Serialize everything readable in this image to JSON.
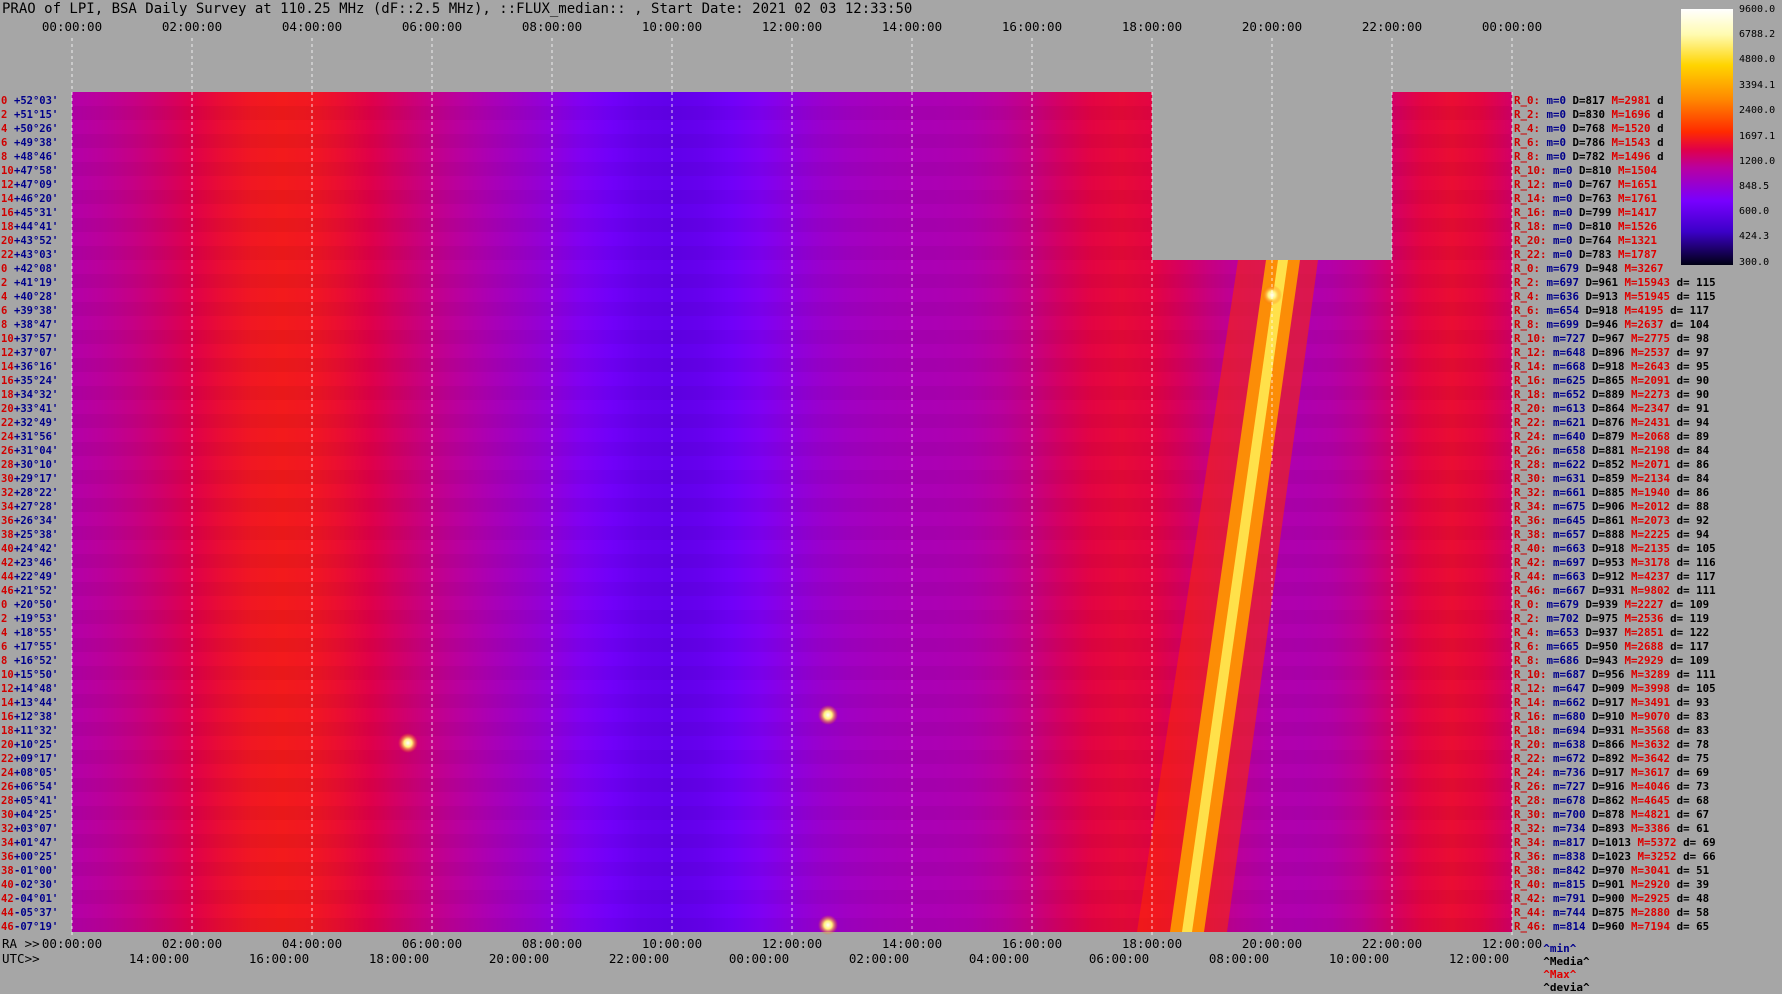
{
  "title": "PRAO of LPI, BSA Daily Survey at 110.25 MHz (dF::2.5 MHz), ::FLUX_median:: , Start Date: 2021 02 03 12:33:50",
  "top_utc_ticks": [
    "00:00:00",
    "02:00:00",
    "04:00:00",
    "06:00:00",
    "08:00:00",
    "10:00:00",
    "12:00:00",
    "14:00:00",
    "16:00:00",
    "18:00:00",
    "20:00:00",
    "22:00:00",
    "00:00:00"
  ],
  "bottom_ra_prefix": "RA >>",
  "bottom_ra_ticks": [
    "00:00:00",
    "02:00:00",
    "04:00:00",
    "06:00:00",
    "08:00:00",
    "10:00:00",
    "12:00:00",
    "14:00:00",
    "16:00:00",
    "18:00:00",
    "20:00:00",
    "22:00:00",
    "12:00:00"
  ],
  "bottom_utc_prefix": "UTC>>",
  "bottom_utc_ticks": [
    "14:00:00",
    "16:00:00",
    "18:00:00",
    "20:00:00",
    "22:00:00",
    "00:00:00",
    "02:00:00",
    "04:00:00",
    "06:00:00",
    "08:00:00",
    "10:00:00",
    "12:00:00"
  ],
  "legend_footer": {
    "min": "^min^",
    "median": "^Media^",
    "max": "^Max^",
    "dev": "^devia^"
  },
  "colorbar": {
    "labels": [
      "9600.0",
      "6788.2",
      "4800.0",
      "3394.1",
      "2400.0",
      "1697.1",
      "1200.0",
      "848.5",
      "600.0",
      "424.3",
      "300.0"
    ],
    "scale": "log",
    "colors": [
      "#ffffff",
      "#fffbb0",
      "#ffd400",
      "#ff8a00",
      "#ff2a00",
      "#e0004a",
      "#b900a0",
      "#7800ff",
      "#3c00c8",
      "#000014"
    ]
  },
  "declinations": [
    {
      "idx": "0",
      "dec": "+52°03'"
    },
    {
      "idx": "2",
      "dec": "+51°15'"
    },
    {
      "idx": "4",
      "dec": "+50°26'"
    },
    {
      "idx": "6",
      "dec": "+49°38'"
    },
    {
      "idx": "8",
      "dec": "+48°46'"
    },
    {
      "idx": "10",
      "dec": "+47°58'"
    },
    {
      "idx": "12",
      "dec": "+47°09'"
    },
    {
      "idx": "14",
      "dec": "+46°20'"
    },
    {
      "idx": "16",
      "dec": "+45°31'"
    },
    {
      "idx": "18",
      "dec": "+44°41'"
    },
    {
      "idx": "20",
      "dec": "+43°52'"
    },
    {
      "idx": "22",
      "dec": "+43°03'"
    },
    {
      "idx": "0",
      "dec": "+42°08'"
    },
    {
      "idx": "2",
      "dec": "+41°19'"
    },
    {
      "idx": "4",
      "dec": "+40°28'"
    },
    {
      "idx": "6",
      "dec": "+39°38'"
    },
    {
      "idx": "8",
      "dec": "+38°47'"
    },
    {
      "idx": "10",
      "dec": "+37°57'"
    },
    {
      "idx": "12",
      "dec": "+37°07'"
    },
    {
      "idx": "14",
      "dec": "+36°16'"
    },
    {
      "idx": "16",
      "dec": "+35°24'"
    },
    {
      "idx": "18",
      "dec": "+34°32'"
    },
    {
      "idx": "20",
      "dec": "+33°41'"
    },
    {
      "idx": "22",
      "dec": "+32°49'"
    },
    {
      "idx": "24",
      "dec": "+31°56'"
    },
    {
      "idx": "26",
      "dec": "+31°04'"
    },
    {
      "idx": "28",
      "dec": "+30°10'"
    },
    {
      "idx": "30",
      "dec": "+29°17'"
    },
    {
      "idx": "32",
      "dec": "+28°22'"
    },
    {
      "idx": "34",
      "dec": "+27°28'"
    },
    {
      "idx": "36",
      "dec": "+26°34'"
    },
    {
      "idx": "38",
      "dec": "+25°38'"
    },
    {
      "idx": "40",
      "dec": "+24°42'"
    },
    {
      "idx": "42",
      "dec": "+23°46'"
    },
    {
      "idx": "44",
      "dec": "+22°49'"
    },
    {
      "idx": "46",
      "dec": "+21°52'"
    },
    {
      "idx": "0",
      "dec": "+20°50'"
    },
    {
      "idx": "2",
      "dec": "+19°53'"
    },
    {
      "idx": "4",
      "dec": "+18°55'"
    },
    {
      "idx": "6",
      "dec": "+17°55'"
    },
    {
      "idx": "8",
      "dec": "+16°52'"
    },
    {
      "idx": "10",
      "dec": "+15°50'"
    },
    {
      "idx": "12",
      "dec": "+14°48'"
    },
    {
      "idx": "14",
      "dec": "+13°44'"
    },
    {
      "idx": "16",
      "dec": "+12°38'"
    },
    {
      "idx": "18",
      "dec": "+11°32'"
    },
    {
      "idx": "20",
      "dec": "+10°25'"
    },
    {
      "idx": "22",
      "dec": "+09°17'"
    },
    {
      "idx": "24",
      "dec": "+08°05'"
    },
    {
      "idx": "26",
      "dec": "+06°54'"
    },
    {
      "idx": "28",
      "dec": "+05°41'"
    },
    {
      "idx": "30",
      "dec": "+04°25'"
    },
    {
      "idx": "32",
      "dec": "+03°07'"
    },
    {
      "idx": "34",
      "dec": "+01°47'"
    },
    {
      "idx": "36",
      "dec": "+00°25'"
    },
    {
      "idx": "38",
      "dec": "-01°00'"
    },
    {
      "idx": "40",
      "dec": "-02°30'"
    },
    {
      "idx": "42",
      "dec": "-04°01'"
    },
    {
      "idx": "44",
      "dec": "-05°37'"
    },
    {
      "idx": "46",
      "dec": "-07°19'"
    }
  ],
  "stats": [
    {
      "r": "R_0:",
      "m": "m=0",
      "D": "D=817",
      "M": "M=2981",
      "d": "d"
    },
    {
      "r": "R_2:",
      "m": "m=0",
      "D": "D=830",
      "M": "M=1696",
      "d": "d"
    },
    {
      "r": "R_4:",
      "m": "m=0",
      "D": "D=768",
      "M": "M=1520",
      "d": "d"
    },
    {
      "r": "R_6:",
      "m": "m=0",
      "D": "D=786",
      "M": "M=1543",
      "d": "d"
    },
    {
      "r": "R_8:",
      "m": "m=0",
      "D": "D=782",
      "M": "M=1496",
      "d": "d"
    },
    {
      "r": "R_10:",
      "m": "m=0",
      "D": "D=810",
      "M": "M=1504",
      "d": ""
    },
    {
      "r": "R_12:",
      "m": "m=0",
      "D": "D=767",
      "M": "M=1651",
      "d": ""
    },
    {
      "r": "R_14:",
      "m": "m=0",
      "D": "D=763",
      "M": "M=1761",
      "d": ""
    },
    {
      "r": "R_16:",
      "m": "m=0",
      "D": "D=799",
      "M": "M=1417",
      "d": ""
    },
    {
      "r": "R_18:",
      "m": "m=0",
      "D": "D=810",
      "M": "M=1526",
      "d": ""
    },
    {
      "r": "R_20:",
      "m": "m=0",
      "D": "D=764",
      "M": "M=1321",
      "d": ""
    },
    {
      "r": "R_22:",
      "m": "m=0",
      "D": "D=783",
      "M": "M=1787",
      "d": ""
    },
    {
      "r": "R_0:",
      "m": "m=679",
      "D": "D=948",
      "M": "M=3267",
      "d": ""
    },
    {
      "r": "R_2:",
      "m": "m=697",
      "D": "D=961",
      "M": "M=15943",
      "d": "d= 115"
    },
    {
      "r": "R_4:",
      "m": "m=636",
      "D": "D=913",
      "M": "M=51945",
      "d": "d= 115"
    },
    {
      "r": "R_6:",
      "m": "m=654",
      "D": "D=918",
      "M": "M=4195",
      "d": "d= 117"
    },
    {
      "r": "R_8:",
      "m": "m=699",
      "D": "D=946",
      "M": "M=2637",
      "d": "d= 104"
    },
    {
      "r": "R_10:",
      "m": "m=727",
      "D": "D=967",
      "M": "M=2775",
      "d": "d= 98"
    },
    {
      "r": "R_12:",
      "m": "m=648",
      "D": "D=896",
      "M": "M=2537",
      "d": "d= 97"
    },
    {
      "r": "R_14:",
      "m": "m=668",
      "D": "D=918",
      "M": "M=2643",
      "d": "d= 95"
    },
    {
      "r": "R_16:",
      "m": "m=625",
      "D": "D=865",
      "M": "M=2091",
      "d": "d= 90"
    },
    {
      "r": "R_18:",
      "m": "m=652",
      "D": "D=889",
      "M": "M=2273",
      "d": "d= 90"
    },
    {
      "r": "R_20:",
      "m": "m=613",
      "D": "D=864",
      "M": "M=2347",
      "d": "d= 91"
    },
    {
      "r": "R_22:",
      "m": "m=621",
      "D": "D=876",
      "M": "M=2431",
      "d": "d= 94"
    },
    {
      "r": "R_24:",
      "m": "m=640",
      "D": "D=879",
      "M": "M=2068",
      "d": "d= 89"
    },
    {
      "r": "R_26:",
      "m": "m=658",
      "D": "D=881",
      "M": "M=2198",
      "d": "d= 84"
    },
    {
      "r": "R_28:",
      "m": "m=622",
      "D": "D=852",
      "M": "M=2071",
      "d": "d= 86"
    },
    {
      "r": "R_30:",
      "m": "m=631",
      "D": "D=859",
      "M": "M=2134",
      "d": "d= 84"
    },
    {
      "r": "R_32:",
      "m": "m=661",
      "D": "D=885",
      "M": "M=1940",
      "d": "d= 86"
    },
    {
      "r": "R_34:",
      "m": "m=675",
      "D": "D=906",
      "M": "M=2012",
      "d": "d= 88"
    },
    {
      "r": "R_36:",
      "m": "m=645",
      "D": "D=861",
      "M": "M=2073",
      "d": "d= 92"
    },
    {
      "r": "R_38:",
      "m": "m=657",
      "D": "D=888",
      "M": "M=2225",
      "d": "d= 94"
    },
    {
      "r": "R_40:",
      "m": "m=663",
      "D": "D=918",
      "M": "M=2135",
      "d": "d= 105"
    },
    {
      "r": "R_42:",
      "m": "m=697",
      "D": "D=953",
      "M": "M=3178",
      "d": "d= 116"
    },
    {
      "r": "R_44:",
      "m": "m=663",
      "D": "D=912",
      "M": "M=4237",
      "d": "d= 117"
    },
    {
      "r": "R_46:",
      "m": "m=667",
      "D": "D=931",
      "M": "M=9802",
      "d": "d= 111"
    },
    {
      "r": "R_0:",
      "m": "m=679",
      "D": "D=939",
      "M": "M=2227",
      "d": "d= 109"
    },
    {
      "r": "R_2:",
      "m": "m=702",
      "D": "D=975",
      "M": "M=2536",
      "d": "d= 119"
    },
    {
      "r": "R_4:",
      "m": "m=653",
      "D": "D=937",
      "M": "M=2851",
      "d": "d= 122"
    },
    {
      "r": "R_6:",
      "m": "m=665",
      "D": "D=950",
      "M": "M=2688",
      "d": "d= 117"
    },
    {
      "r": "R_8:",
      "m": "m=686",
      "D": "D=943",
      "M": "M=2929",
      "d": "d= 109"
    },
    {
      "r": "R_10:",
      "m": "m=687",
      "D": "D=956",
      "M": "M=3289",
      "d": "d= 111"
    },
    {
      "r": "R_12:",
      "m": "m=647",
      "D": "D=909",
      "M": "M=3998",
      "d": "d= 105"
    },
    {
      "r": "R_14:",
      "m": "m=662",
      "D": "D=917",
      "M": "M=3491",
      "d": "d= 93"
    },
    {
      "r": "R_16:",
      "m": "m=680",
      "D": "D=910",
      "M": "M=9070",
      "d": "d= 83"
    },
    {
      "r": "R_18:",
      "m": "m=694",
      "D": "D=931",
      "M": "M=3568",
      "d": "d= 83"
    },
    {
      "r": "R_20:",
      "m": "m=638",
      "D": "D=866",
      "M": "M=3632",
      "d": "d= 78"
    },
    {
      "r": "R_22:",
      "m": "m=672",
      "D": "D=892",
      "M": "M=3642",
      "d": "d= 75"
    },
    {
      "r": "R_24:",
      "m": "m=736",
      "D": "D=917",
      "M": "M=3617",
      "d": "d= 69"
    },
    {
      "r": "R_26:",
      "m": "m=727",
      "D": "D=916",
      "M": "M=4046",
      "d": "d= 73"
    },
    {
      "r": "R_28:",
      "m": "m=678",
      "D": "D=862",
      "M": "M=4645",
      "d": "d= 68"
    },
    {
      "r": "R_30:",
      "m": "m=700",
      "D": "D=878",
      "M": "M=4821",
      "d": "d= 67"
    },
    {
      "r": "R_32:",
      "m": "m=734",
      "D": "D=893",
      "M": "M=3386",
      "d": "d= 61"
    },
    {
      "r": "R_34:",
      "m": "m=817",
      "D": "D=1013",
      "M": "M=5372",
      "d": "d= 69"
    },
    {
      "r": "R_36:",
      "m": "m=838",
      "D": "D=1023",
      "M": "M=3252",
      "d": "d= 66"
    },
    {
      "r": "R_38:",
      "m": "m=842",
      "D": "D=970",
      "M": "M=3041",
      "d": "d= 51"
    },
    {
      "r": "R_40:",
      "m": "m=815",
      "D": "D=901",
      "M": "M=2920",
      "d": "d= 39"
    },
    {
      "r": "R_42:",
      "m": "m=791",
      "D": "D=900",
      "M": "M=2925",
      "d": "d= 48"
    },
    {
      "r": "R_44:",
      "m": "m=744",
      "D": "D=875",
      "M": "M=2880",
      "d": "d= 58"
    },
    {
      "r": "R_46:",
      "m": "m=814",
      "D": "D=960",
      "M": "M=7194",
      "d": "d= 65"
    }
  ],
  "chart_data": {
    "type": "heatmap",
    "title": "PRAO of LPI, BSA Daily Survey at 110.25 MHz (dF::2.5 MHz), ::FLUX_median:: , Start Date: 2021 02 03 12:33:50",
    "x_axis": "RA (hours)",
    "x_range": [
      0,
      24
    ],
    "colorscale_range": [
      300,
      9600
    ],
    "colorscale": "log",
    "missing_block_ra": [
      18,
      22
    ],
    "missing_block_rows": [
      0,
      11
    ],
    "features": [
      {
        "kind": "enhancement-band",
        "ra_center": 3.5,
        "level": 1600
      },
      {
        "kind": "cold-region",
        "ra_from": 8.3,
        "ra_to": 12.0,
        "level": 600
      },
      {
        "kind": "galactic-plane",
        "ra_top": 20.1,
        "ra_bottom": 18.5,
        "level": 5000
      },
      {
        "kind": "point-source",
        "ra": 20.0,
        "row": 14,
        "level": 9600
      },
      {
        "kind": "point-source",
        "ra": 5.6,
        "row": 46,
        "level": 5000
      },
      {
        "kind": "point-source",
        "ra": 12.6,
        "row": 59,
        "level": 7000
      },
      {
        "kind": "point-source",
        "ra": 12.6,
        "row": 44,
        "level": 4500
      }
    ]
  }
}
